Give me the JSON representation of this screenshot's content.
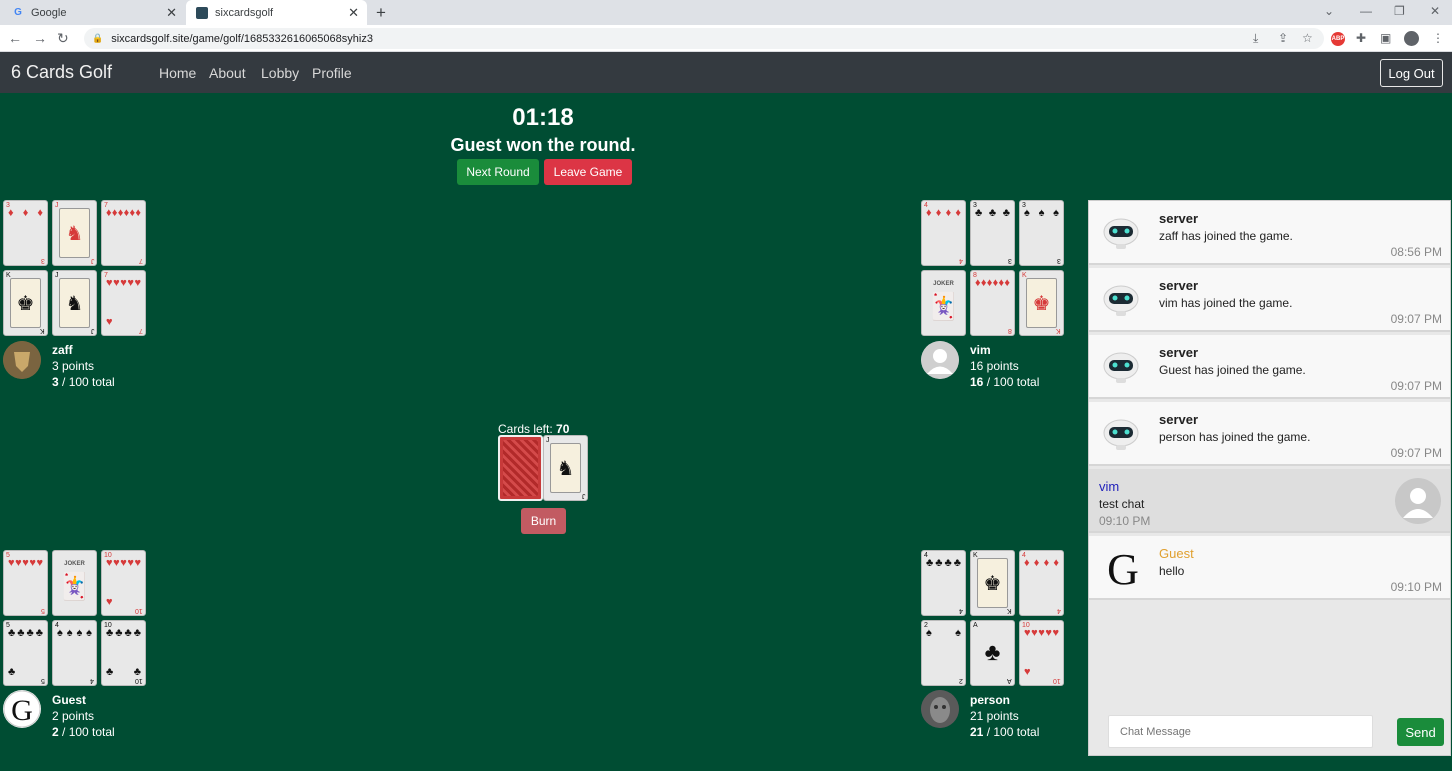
{
  "browser": {
    "tabs": [
      {
        "title": "Google"
      },
      {
        "title": "sixcardsgolf"
      }
    ],
    "url": "sixcardsgolf.site/game/golf/1685332616065068syhiz3"
  },
  "site": {
    "brand": "6 Cards Golf",
    "nav": [
      "Home",
      "About",
      "Lobby",
      "Profile"
    ],
    "logout_label": "Log Out"
  },
  "game": {
    "timer": "01:18",
    "round_message": "Guest won the round.",
    "next_round_label": "Next Round",
    "leave_game_label": "Leave Game",
    "cards_left_label": "Cards left:",
    "cards_left_value": "70",
    "burn_label": "Burn"
  },
  "players": [
    {
      "name": "zaff",
      "points": "3 points",
      "total": "3",
      "total_suffix": " / 100 total",
      "cards": [
        {
          "rank": "3",
          "suit": "♦",
          "color": "red"
        },
        {
          "rank": "J",
          "suit": "♦",
          "color": "red"
        },
        {
          "rank": "7",
          "suit": "♦",
          "color": "red"
        },
        {
          "rank": "K",
          "suit": "♠",
          "color": "blk"
        },
        {
          "rank": "J",
          "suit": "♠",
          "color": "blk"
        },
        {
          "rank": "7",
          "suit": "♥",
          "color": "red"
        }
      ]
    },
    {
      "name": "vim",
      "points": "16 points",
      "total": "16",
      "total_suffix": " / 100 total",
      "cards": [
        {
          "rank": "4",
          "suit": "♦",
          "color": "red"
        },
        {
          "rank": "3",
          "suit": "♣",
          "color": "blk"
        },
        {
          "rank": "3",
          "suit": "♠",
          "color": "blk"
        },
        {
          "rank": "JOKER",
          "suit": "",
          "color": "blk"
        },
        {
          "rank": "8",
          "suit": "♦",
          "color": "red"
        },
        {
          "rank": "K",
          "suit": "♦",
          "color": "red"
        }
      ]
    },
    {
      "name": "Guest",
      "points": "2 points",
      "total": "2",
      "total_suffix": " / 100 total",
      "cards": [
        {
          "rank": "5",
          "suit": "♥",
          "color": "red"
        },
        {
          "rank": "JOKER",
          "suit": "",
          "color": "blk"
        },
        {
          "rank": "10",
          "suit": "♥",
          "color": "red"
        },
        {
          "rank": "5",
          "suit": "♣",
          "color": "blk"
        },
        {
          "rank": "4",
          "suit": "♠",
          "color": "blk"
        },
        {
          "rank": "10",
          "suit": "♣",
          "color": "blk"
        }
      ]
    },
    {
      "name": "person",
      "points": "21 points",
      "total": "21",
      "total_suffix": " / 100 total",
      "cards": [
        {
          "rank": "4",
          "suit": "♣",
          "color": "blk"
        },
        {
          "rank": "K",
          "suit": "♣",
          "color": "blk"
        },
        {
          "rank": "4",
          "suit": "♦",
          "color": "red"
        },
        {
          "rank": "2",
          "suit": "♠",
          "color": "blk"
        },
        {
          "rank": "A",
          "suit": "♣",
          "color": "blk"
        },
        {
          "rank": "10",
          "suit": "♥",
          "color": "red"
        }
      ]
    }
  ],
  "discard": {
    "rank": "J",
    "suit": "♣",
    "color": "blk"
  },
  "chat": {
    "messages": [
      {
        "sender": "server",
        "text": "zaff has joined the game.",
        "time": "08:56 PM"
      },
      {
        "sender": "server",
        "text": "vim has joined the game.",
        "time": "09:07 PM"
      },
      {
        "sender": "server",
        "text": "Guest has joined the game.",
        "time": "09:07 PM"
      },
      {
        "sender": "server",
        "text": "person has joined the game.",
        "time": "09:07 PM"
      },
      {
        "sender": "vim",
        "text": "test chat",
        "time": "09:10 PM"
      },
      {
        "sender": "Guest",
        "text": "hello",
        "time": "09:10 PM"
      }
    ],
    "input_placeholder": "Chat Message",
    "send_label": "Send",
    "colors": {
      "vim": "#2222bb",
      "Guest": "#e0a030"
    }
  }
}
